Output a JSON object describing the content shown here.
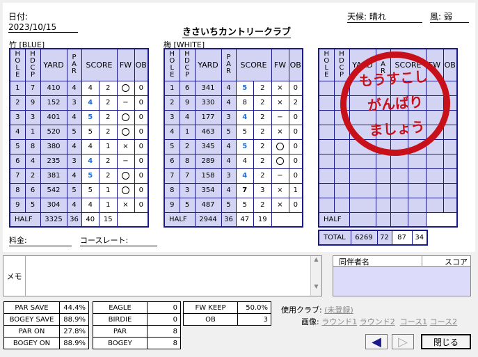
{
  "header": {
    "date": "日付: 2023/10/15",
    "weather": "天候: 晴れ",
    "wind": "風: 弱",
    "club_name": "きさいちカントリークラブ"
  },
  "columns": {
    "hole": "HOLE",
    "hdcp": "HDCP",
    "yard": "YARD",
    "par": "PAR",
    "score": "SCORE",
    "fw": "FW",
    "ob": "OB"
  },
  "out": {
    "label": "竹 [BLUE]",
    "rows": [
      [
        "1",
        "7",
        "410",
        "4",
        "4",
        "2",
        "circle",
        "0",
        "k"
      ],
      [
        "2",
        "9",
        "152",
        "3",
        "4",
        "2",
        "dash",
        "0",
        "b"
      ],
      [
        "3",
        "3",
        "401",
        "4",
        "5",
        "2",
        "circle",
        "0",
        "b"
      ],
      [
        "4",
        "1",
        "520",
        "5",
        "5",
        "2",
        "circle",
        "0",
        "k"
      ],
      [
        "5",
        "8",
        "380",
        "4",
        "4",
        "1",
        "cross",
        "0",
        "k"
      ],
      [
        "6",
        "4",
        "235",
        "3",
        "4",
        "2",
        "dash",
        "0",
        "b"
      ],
      [
        "7",
        "2",
        "381",
        "4",
        "5",
        "2",
        "circle",
        "0",
        "b"
      ],
      [
        "8",
        "6",
        "542",
        "5",
        "5",
        "1",
        "circle",
        "0",
        "k"
      ],
      [
        "9",
        "5",
        "304",
        "4",
        "4",
        "1",
        "cross",
        "0",
        "k"
      ]
    ],
    "half": {
      "label": "HALF",
      "yard": "3325",
      "par": "36",
      "score": "40",
      "putts": "15"
    }
  },
  "in": {
    "label": "梅 [WHITE]",
    "rows": [
      [
        "1",
        "6",
        "341",
        "4",
        "5",
        "2",
        "cross",
        "0",
        "b"
      ],
      [
        "2",
        "9",
        "330",
        "4",
        "8",
        "2",
        "cross",
        "2",
        "k"
      ],
      [
        "3",
        "4",
        "177",
        "3",
        "4",
        "2",
        "dash",
        "0",
        "b"
      ],
      [
        "4",
        "1",
        "463",
        "5",
        "5",
        "2",
        "cross",
        "0",
        "k"
      ],
      [
        "5",
        "2",
        "345",
        "4",
        "5",
        "2",
        "circle",
        "0",
        "b"
      ],
      [
        "6",
        "8",
        "289",
        "4",
        "4",
        "2",
        "circle",
        "0",
        "k"
      ],
      [
        "7",
        "7",
        "158",
        "3",
        "4",
        "2",
        "dash",
        "0",
        "b"
      ],
      [
        "8",
        "3",
        "354",
        "4",
        "7",
        "3",
        "cross",
        "1",
        "bk"
      ],
      [
        "9",
        "5",
        "487",
        "5",
        "5",
        "2",
        "cross",
        "0",
        "k"
      ]
    ],
    "half": {
      "label": "HALF",
      "yard": "2944",
      "par": "36",
      "score": "47",
      "putts": "19"
    }
  },
  "third": {
    "half_label": "HALF",
    "total_label": "TOTAL",
    "total_yard": "6269",
    "total_par": "72",
    "total_score": "87",
    "total_putts": "34"
  },
  "stamp": {
    "line1": "もうすこし",
    "line2": "がんばり",
    "line3": "ましょう"
  },
  "fee_label": "料金:",
  "course_rate_label": "コースレート:",
  "memo_label": "メモ",
  "companions": {
    "col_name": "同伴者名",
    "col_score": "スコア"
  },
  "stats1": [
    [
      "PAR SAVE",
      "44.4%"
    ],
    [
      "BOGEY SAVE",
      "88.9%"
    ],
    [
      "PAR ON",
      "27.8%"
    ],
    [
      "BOGEY ON",
      "88.9%"
    ]
  ],
  "stats2": [
    [
      "EAGLE",
      "0"
    ],
    [
      "BIRDIE",
      "0"
    ],
    [
      "PAR",
      "8"
    ],
    [
      "BOGEY",
      "8"
    ]
  ],
  "stats3": [
    [
      "FW KEEP",
      "50.0%"
    ],
    [
      "OB",
      "3"
    ]
  ],
  "club_used": {
    "label": "使用クラブ:",
    "value": "(未登録)"
  },
  "images": {
    "label": "画像:",
    "round1": "ラウンド1",
    "round2": "ラウンド2",
    "course1": "コース1",
    "course2": "コース2"
  },
  "buttons": {
    "close": "閉じる"
  },
  "colors": {
    "grid": "#1a1a8c",
    "cell_blue": "#d3d3f3",
    "score_blue": "#1f6fd6",
    "stamp": "#c8101a"
  }
}
